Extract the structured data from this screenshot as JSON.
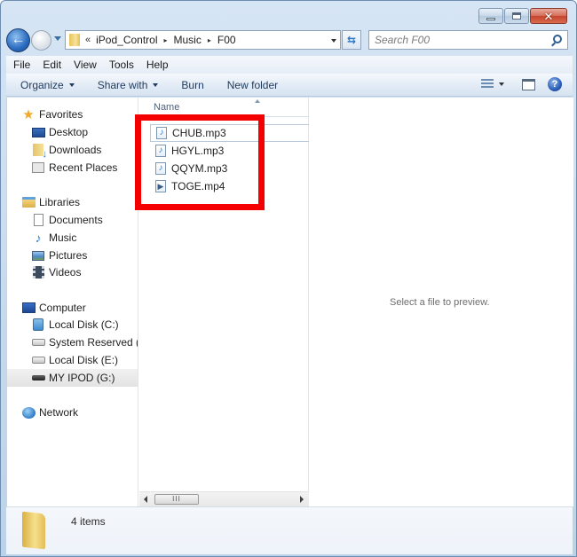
{
  "window": {
    "caption_buttons": {
      "minimize": "minimize",
      "maximize": "maximize",
      "close": "✕"
    }
  },
  "address_bar": {
    "overflow_chevron": "«",
    "breadcrumbs": [
      "iPod_Control",
      "Music",
      "F00"
    ],
    "separator": "▸"
  },
  "search": {
    "placeholder": "Search F00",
    "value": ""
  },
  "menu_bar": {
    "items": [
      "File",
      "Edit",
      "View",
      "Tools",
      "Help"
    ]
  },
  "command_bar": {
    "organize": "Organize",
    "share_with": "Share with",
    "burn": "Burn",
    "new_folder": "New folder",
    "help_glyph": "?"
  },
  "nav_pane": {
    "favorites": {
      "label": "Favorites",
      "items": [
        "Desktop",
        "Downloads",
        "Recent Places"
      ]
    },
    "libraries": {
      "label": "Libraries",
      "items": [
        "Documents",
        "Music",
        "Pictures",
        "Videos"
      ]
    },
    "computer": {
      "label": "Computer",
      "items": [
        "Local Disk (C:)",
        "System Reserved (D:",
        "Local Disk (E:)",
        "MY IPOD (G:)"
      ],
      "selected": "MY IPOD (G:)"
    },
    "network": {
      "label": "Network"
    }
  },
  "file_list": {
    "column_header": "Name",
    "files": [
      {
        "name": "CHUB.mp3",
        "type": "audio"
      },
      {
        "name": "HGYL.mp3",
        "type": "audio"
      },
      {
        "name": "QQYM.mp3",
        "type": "audio"
      },
      {
        "name": "TOGE.mp4",
        "type": "video"
      }
    ],
    "scrollbar_grip": "III"
  },
  "annotation": {
    "highlight_color": "#f40000"
  },
  "preview_pane": {
    "message": "Select a file to preview."
  },
  "details_pane": {
    "item_count": "4 items"
  }
}
